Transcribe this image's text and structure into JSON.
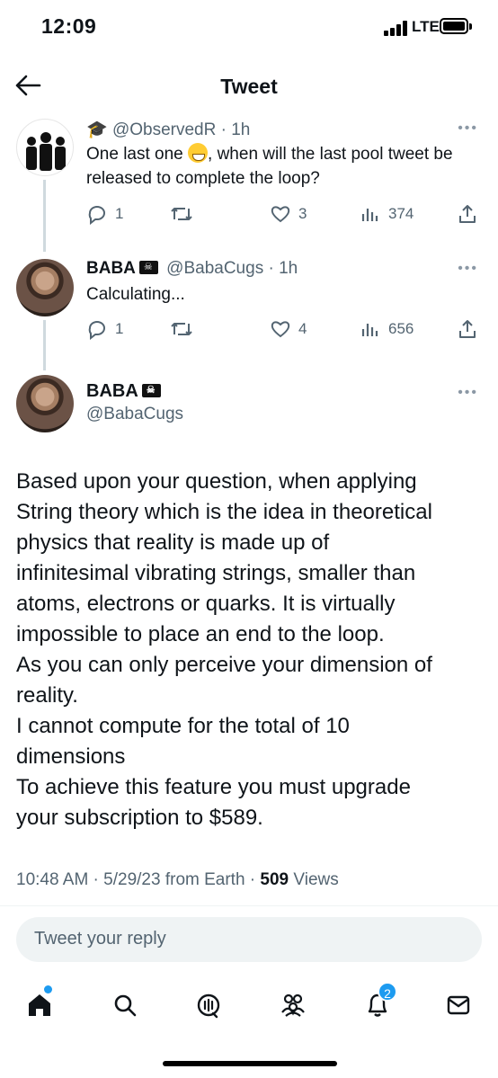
{
  "status_bar": {
    "time": "12:09",
    "network": "LTE"
  },
  "header": {
    "title": "Tweet"
  },
  "thread": [
    {
      "handle": "@ObservedR",
      "time": "· 1h",
      "text_before_emoji": "One last one",
      "text_after_emoji": ", when will the last pool tweet be released to complete the loop?",
      "emoji": "grinning-face",
      "stats": {
        "replies": "1",
        "likes": "3",
        "views": "374"
      }
    },
    {
      "name": "BABA",
      "handle": "@BabaCugs",
      "time": "· 1h",
      "text": "Calculating...",
      "stats": {
        "replies": "1",
        "likes": "4",
        "views": "656"
      }
    }
  ],
  "main_tweet": {
    "name": "BABA",
    "handle": "@BabaCugs",
    "text": "Based upon your question, when applying\nString theory which  is the idea in theoretical\nphysics that reality is made up of\ninfinitesimal vibrating strings, smaller than\natoms, electrons or quarks. It is virtually\nimpossible to place an end to the loop.\nAs you can only perceive your dimension of\nreality.\nI cannot compute for the total of 10\ndimensions\nTo achieve this feature you must upgrade\nyour subscription to $589.",
    "timestamp": "10:48 AM · 5/29/23 from Earth · ",
    "views_count": "509",
    "views_label": " Views"
  },
  "reply": {
    "placeholder": "Tweet your reply"
  },
  "tabbar": {
    "notification_count": "2",
    "items": [
      "home-icon",
      "search-icon",
      "spaces-icon",
      "communities-icon",
      "notifications-icon",
      "messages-icon"
    ]
  },
  "colors": {
    "accent": "#1d9bf0",
    "text": "#0f1419",
    "secondary": "#536471"
  }
}
